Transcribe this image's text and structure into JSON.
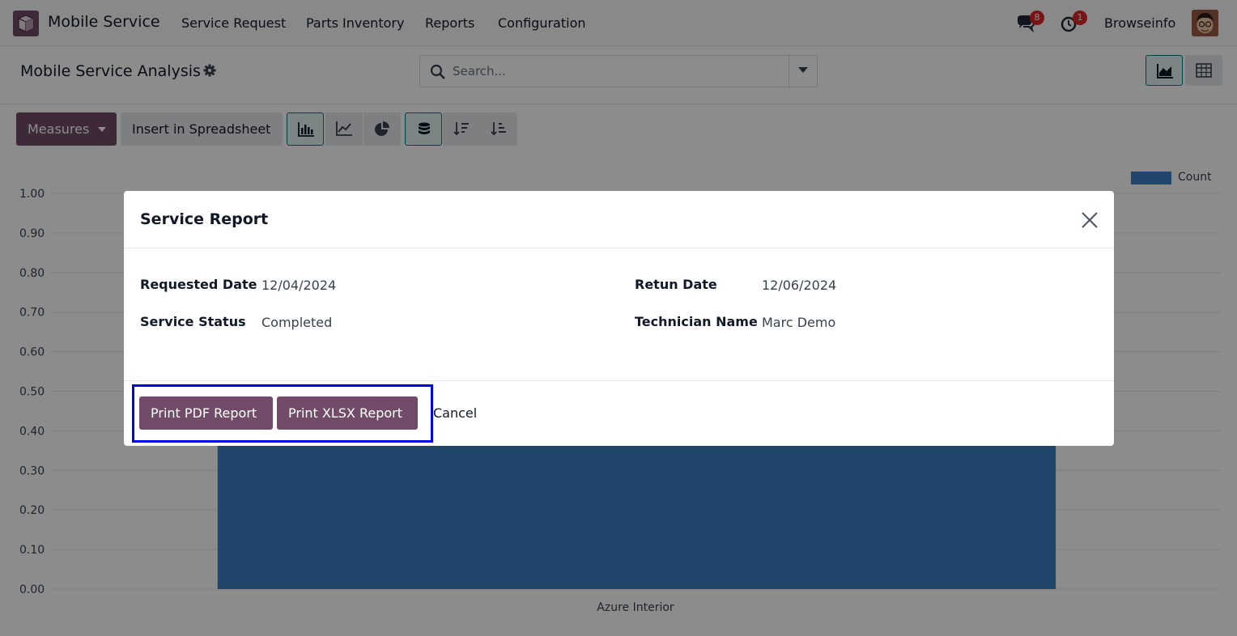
{
  "navbar": {
    "app_name": "Mobile Service",
    "menu": [
      "Service Request",
      "Parts Inventory",
      "Reports",
      "Configuration"
    ],
    "messages_count": "8",
    "activities_count": "1",
    "user_name": "Browseinfo"
  },
  "control_panel": {
    "title": "Mobile Service Analysis",
    "search_placeholder": "Search..."
  },
  "toolbar": {
    "measures_label": "Measures",
    "insert_label": "Insert in Spreadsheet"
  },
  "chart_data": {
    "type": "bar",
    "categories": [
      "Azure Interior"
    ],
    "series": [
      {
        "name": "Count",
        "values": [
          1
        ]
      }
    ],
    "ylim": [
      0,
      1
    ],
    "yticks": [
      "0.00",
      "0.10",
      "0.20",
      "0.30",
      "0.40",
      "0.50",
      "0.60",
      "0.70",
      "0.80",
      "0.90",
      "1.00"
    ],
    "grid": true,
    "legend": "top-right"
  },
  "modal": {
    "title": "Service Report",
    "fields": {
      "requested_date_label": "Requested Date",
      "requested_date_value": "12/04/2024",
      "return_date_label": "Retun Date",
      "return_date_value": "12/06/2024",
      "service_status_label": "Service Status",
      "service_status_value": "Completed",
      "technician_label": "Technician Name",
      "technician_value": "Marc Demo"
    },
    "buttons": {
      "print_pdf": "Print PDF Report",
      "print_xlsx": "Print XLSX Report",
      "cancel": "Cancel"
    }
  },
  "colors": {
    "brand": "#714b67",
    "bar": "#3b82c4",
    "highlight": "#0000e6"
  }
}
